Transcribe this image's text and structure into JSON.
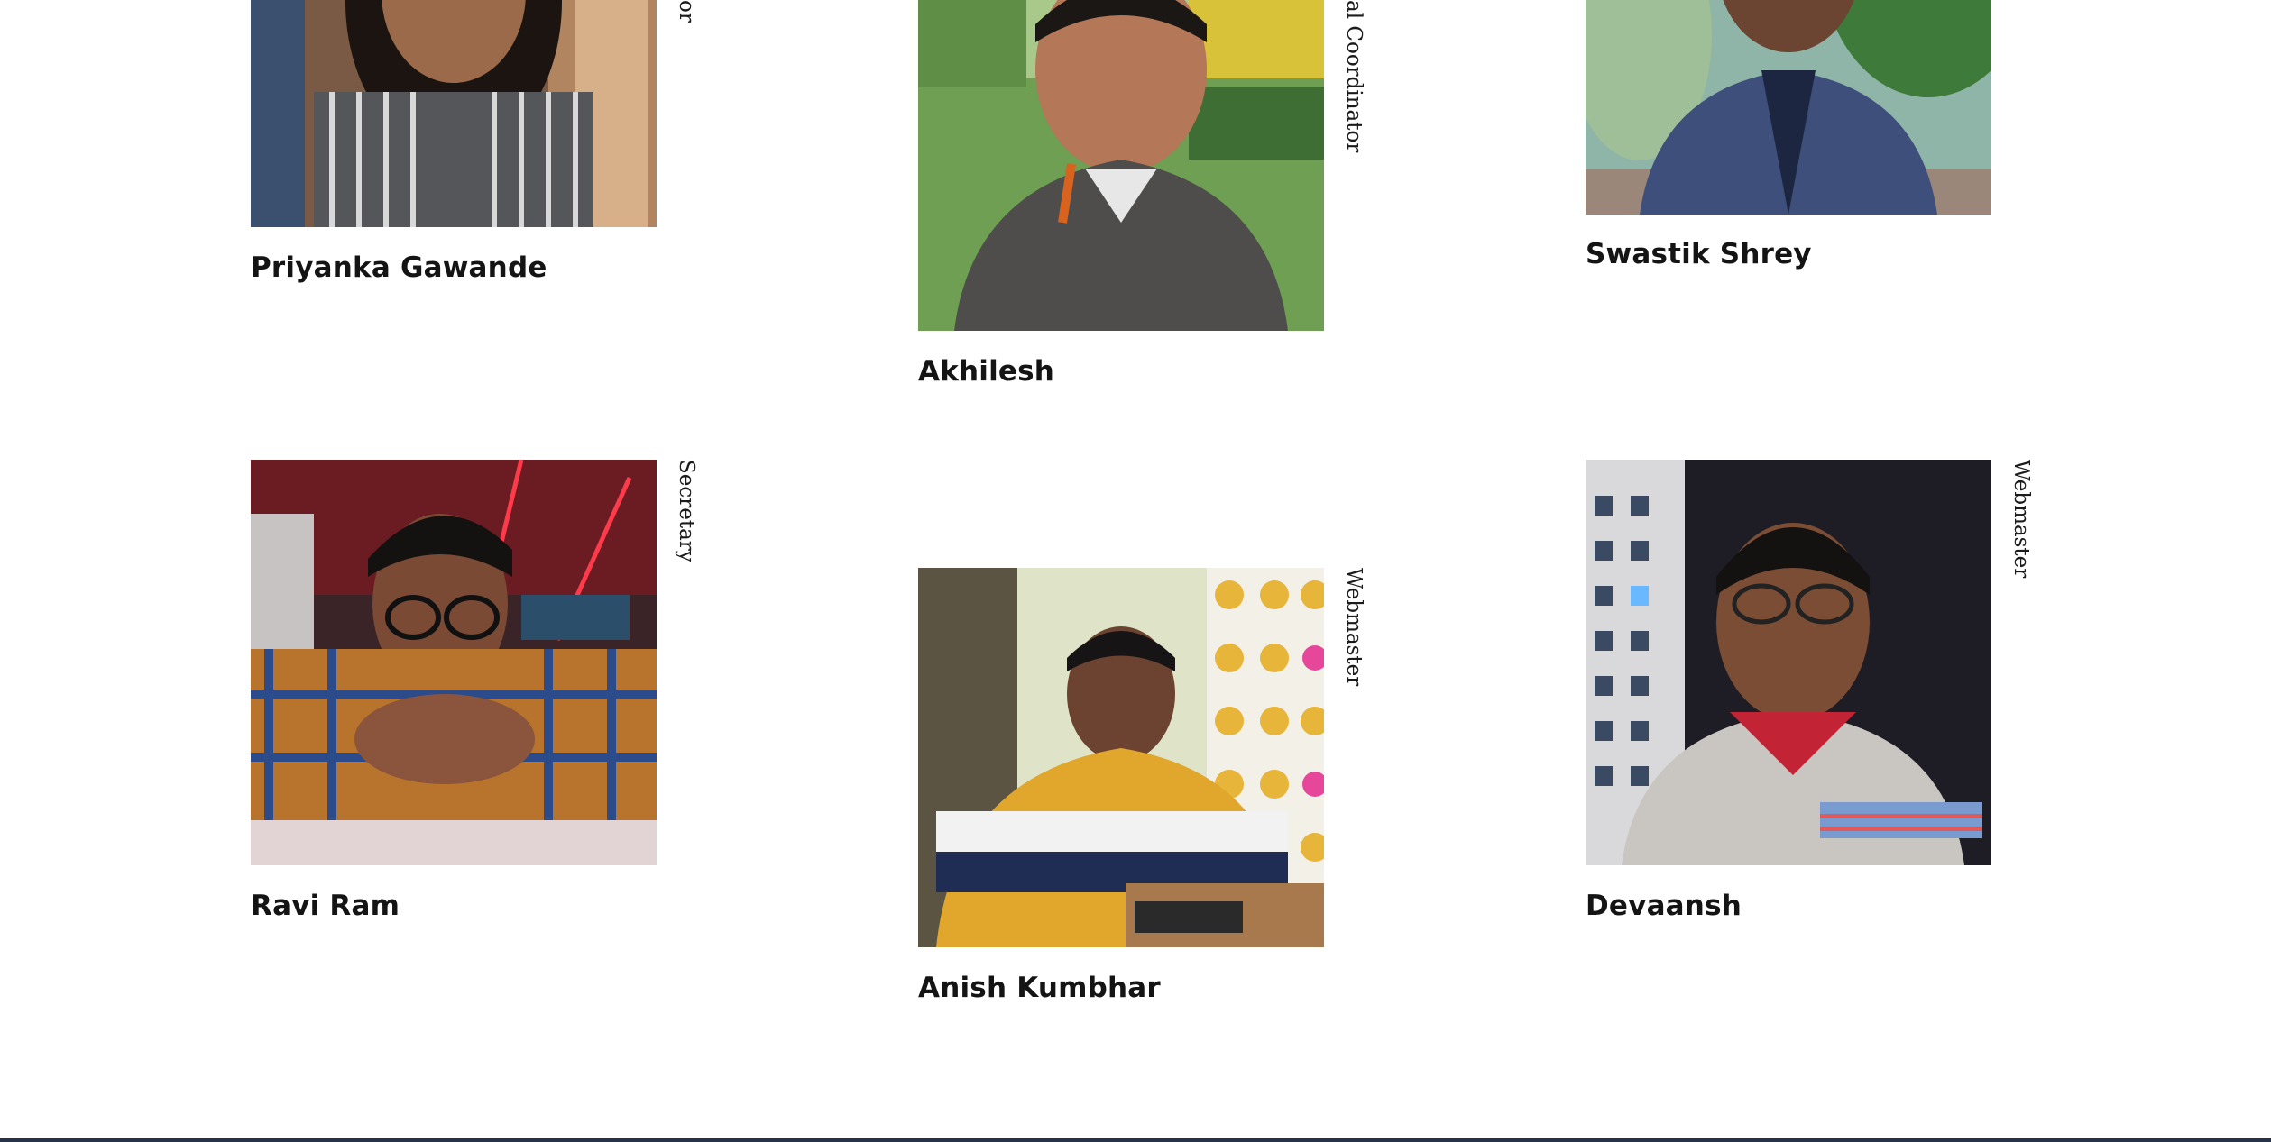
{
  "members": [
    {
      "name": "Priyanka Gawande",
      "role": "or"
    },
    {
      "name": "Akhilesh",
      "role": "al Coordinator"
    },
    {
      "name": "Swastik Shrey",
      "role": ""
    },
    {
      "name": "Ravi Ram",
      "role": "Secretary"
    },
    {
      "name": "Anish Kumbhar",
      "role": "Webmaster"
    },
    {
      "name": "Devaansh",
      "role": "Webmaster"
    }
  ],
  "colors": {
    "name_text": "#141414",
    "role_text": "#1b1b1b",
    "footer_bar": "#26324a",
    "background": "#ffffff"
  }
}
